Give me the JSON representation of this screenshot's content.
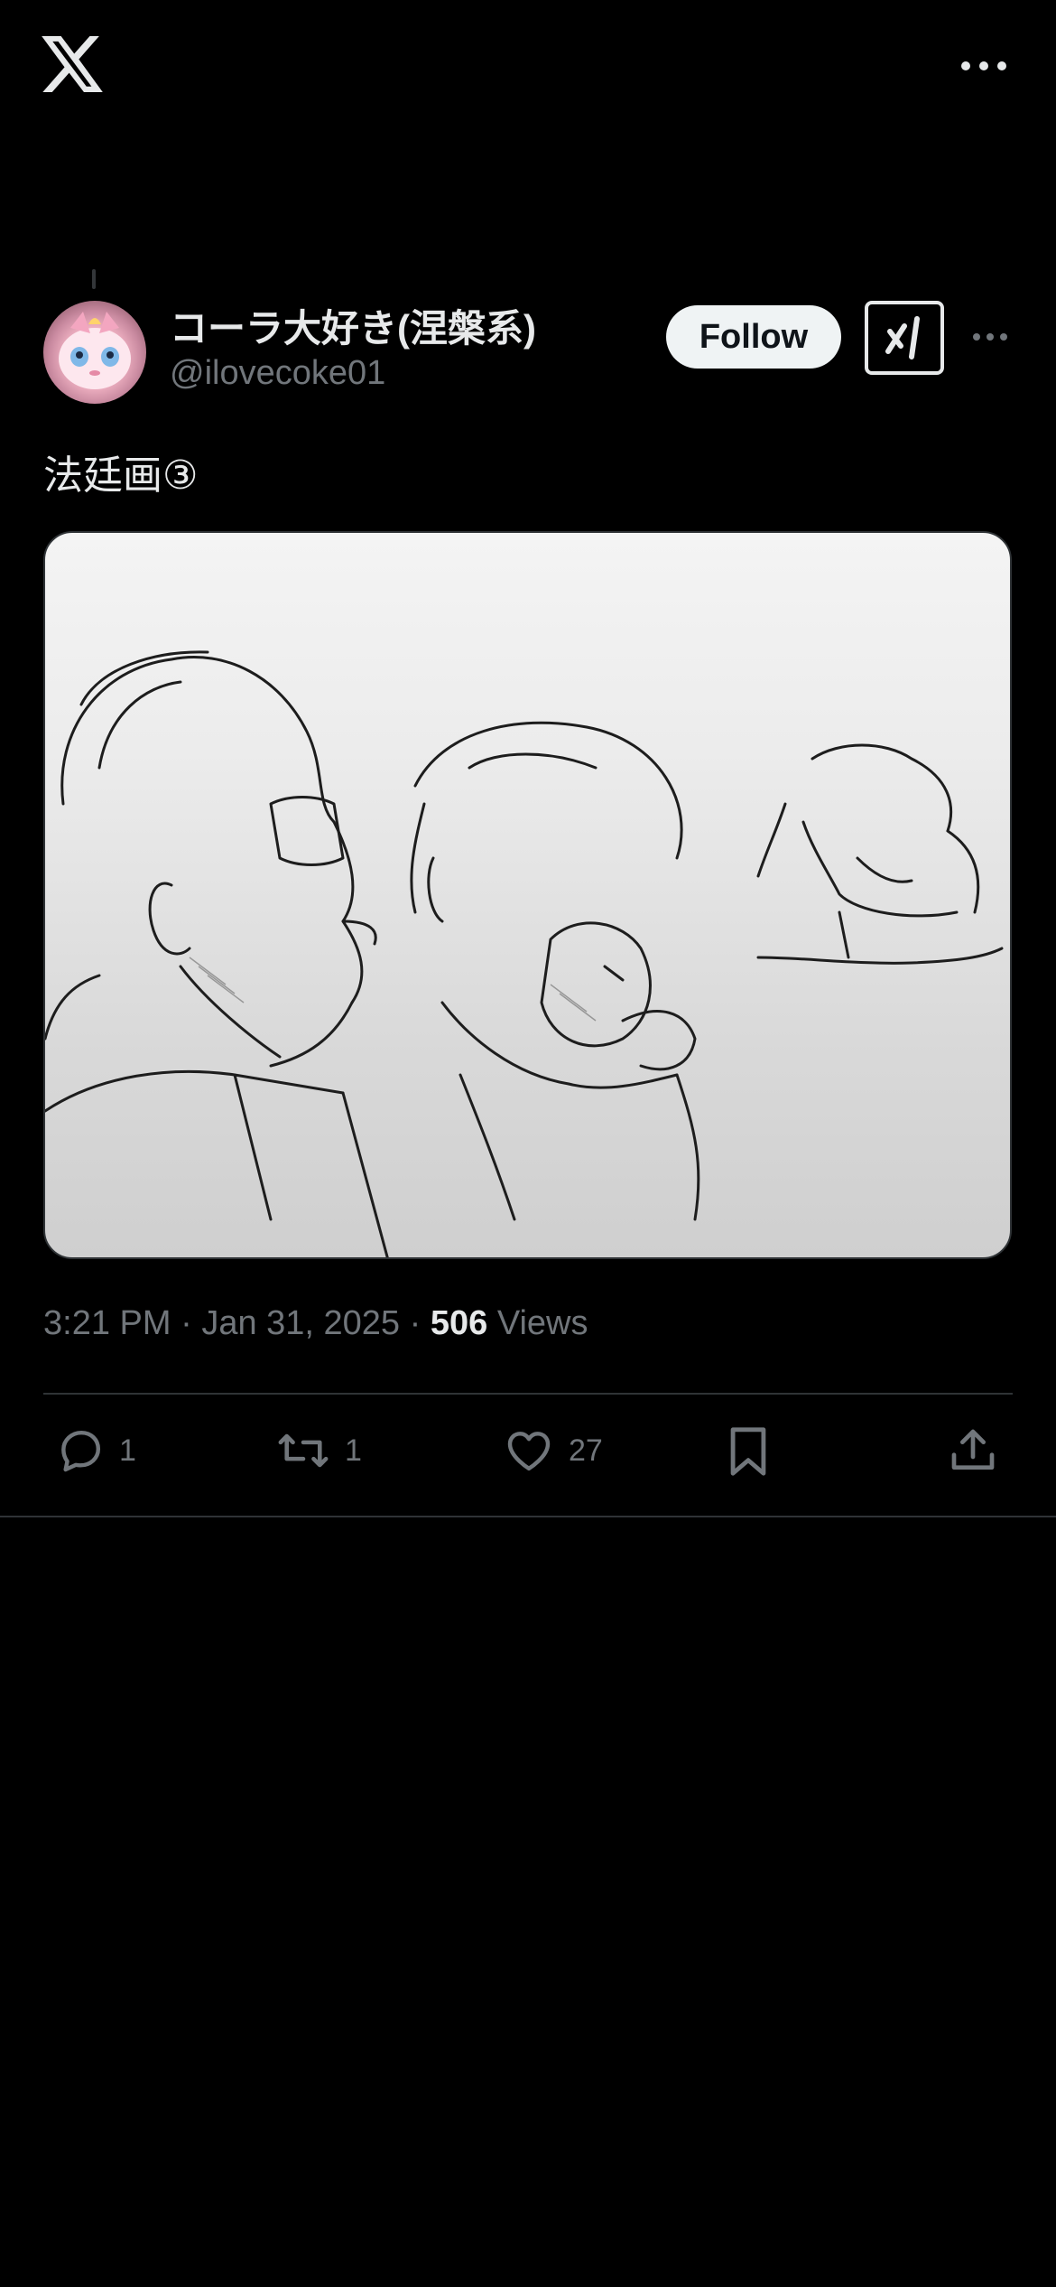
{
  "app": {
    "logo_icon": "x-logo-icon"
  },
  "post": {
    "display_name": "コーラ大好き(涅槃系)",
    "handle": "@ilovecoke01",
    "follow_label": "Follow",
    "text": "法廷画③",
    "media_description": "",
    "time": "3:21 PM",
    "separator": "·",
    "date": "Jan 31, 2025",
    "views_count": "506",
    "views_label": "Views"
  },
  "actions": {
    "replies": "1",
    "reposts": "1",
    "likes": "27"
  },
  "icons": [
    "x-logo-icon",
    "more-icon",
    "grok-icon",
    "reply-icon",
    "repost-icon",
    "like-icon",
    "bookmark-icon",
    "share-icon"
  ],
  "colors": {
    "background": "#000000",
    "text": "#e7e9ea",
    "muted": "#71767b",
    "divider": "#2f3336",
    "follow_bg": "#eff3f4"
  }
}
